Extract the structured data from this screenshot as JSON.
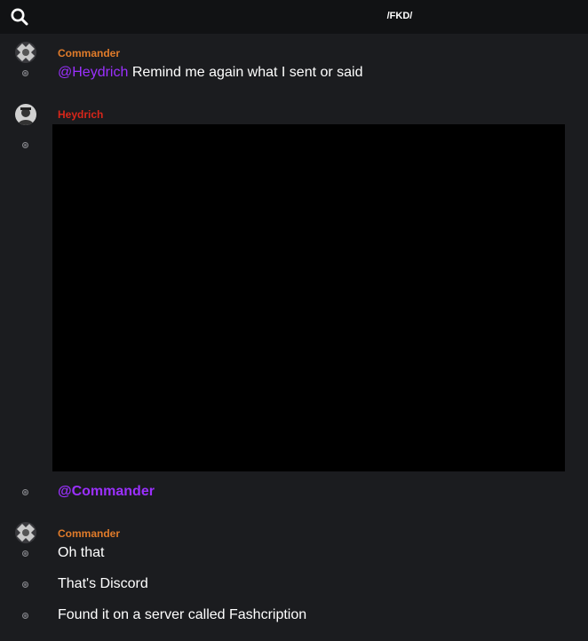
{
  "header": {
    "channel_title": "/FKD/",
    "search_icon": "search-icon"
  },
  "messages": [
    {
      "username": "Commander",
      "username_color": "#e07b2a",
      "mention": "@Heydrich",
      "text": " Remind me again what I sent or said"
    },
    {
      "username": "Heydrich",
      "username_color": "#d8261a",
      "media_color": "#000000",
      "followup_mention": "@Commander"
    },
    {
      "username": "Commander",
      "username_color": "#e07b2a",
      "lines": [
        "Oh that",
        "That's Discord",
        "Found it on a server called Fashcription"
      ]
    }
  ],
  "colors": {
    "background": "#1b1c1f",
    "topbar": "#111214",
    "mention": "#9b30ff"
  }
}
